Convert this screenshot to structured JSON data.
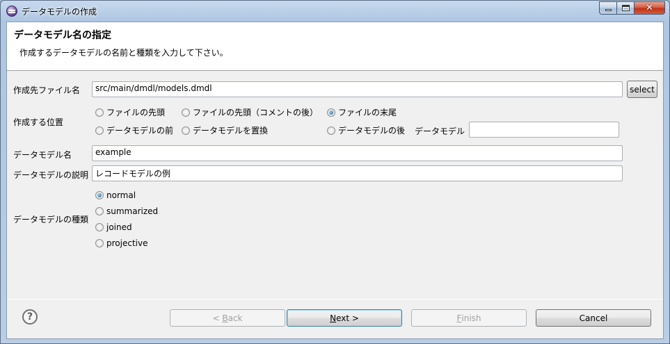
{
  "window": {
    "title": "データモデルの作成"
  },
  "header": {
    "title": "データモデル名の指定",
    "description": "作成するデータモデルの名前と種類を入力して下さい。"
  },
  "form": {
    "file_label": "作成先ファイル名",
    "file_value": "src/main/dmdl/models.dmdl",
    "select_label": "select",
    "position_label": "作成する位置",
    "position_options": [
      {
        "label": "ファイルの先頭",
        "checked": false
      },
      {
        "label": "ファイルの先頭（コメントの後）",
        "checked": false
      },
      {
        "label": "ファイルの末尾",
        "checked": true
      },
      {
        "label": "データモデルの前",
        "checked": false
      },
      {
        "label": "データモデルを置換",
        "checked": false
      },
      {
        "label": "データモデルの後",
        "checked": false
      }
    ],
    "datamodel_ref_label": "データモデル",
    "datamodel_ref_value": "",
    "name_label": "データモデル名",
    "name_value": "example",
    "desc_label": "データモデルの説明",
    "desc_value": "レコードモデルの例",
    "kind_label": "データモデルの種類",
    "kind_options": [
      {
        "label": "normal",
        "checked": true
      },
      {
        "label": "summarized",
        "checked": false
      },
      {
        "label": "joined",
        "checked": false
      },
      {
        "label": "projective",
        "checked": false
      }
    ]
  },
  "footer": {
    "help_glyph": "?",
    "back_prefix": "< ",
    "back_mnemonic": "B",
    "back_rest": "ack",
    "next_mnemonic": "N",
    "next_rest": "ext >",
    "finish_mnemonic": "F",
    "finish_rest": "inish",
    "cancel_label": "Cancel"
  },
  "icons": [
    "app-icon",
    "minimize-icon",
    "maximize-icon",
    "close-icon",
    "help-icon"
  ]
}
